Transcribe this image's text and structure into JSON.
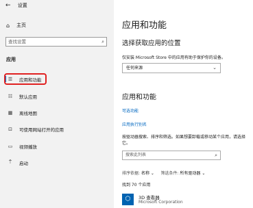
{
  "window": {
    "back_icon": "back-arrow-icon",
    "title": "设置"
  },
  "sidebar": {
    "home_label": "主页",
    "search_placeholder": "查找设置",
    "category": "应用",
    "items": [
      {
        "label": "应用和功能",
        "icon": "apps-list-icon",
        "active": true
      },
      {
        "label": "默认应用",
        "icon": "default-apps-icon",
        "active": false
      },
      {
        "label": "离线地图",
        "icon": "map-icon",
        "active": false
      },
      {
        "label": "可使用网站打开的应用",
        "icon": "website-apps-icon",
        "active": false
      },
      {
        "label": "视频播放",
        "icon": "video-icon",
        "active": false
      },
      {
        "label": "启动",
        "icon": "startup-icon",
        "active": false
      }
    ]
  },
  "main": {
    "title": "应用和功能",
    "install_source": {
      "heading": "选择获取应用的位置",
      "description": "仅安装 Microsoft Store 中的应用有助于保护你的设备。",
      "selected": "任何来源"
    },
    "apps": {
      "heading": "应用和功能",
      "optional_features_link": "可选功能",
      "aliases_link": "应用执行别名",
      "help_text": "按驱动器搜索、排序和筛选。如果想要卸载或移动某个应用，请选择它。",
      "search_placeholder": "搜索此列表",
      "sort_label": "排序依据:",
      "sort_value": "名称",
      "filter_label": "筛选条件:",
      "filter_value": "所有驱动器",
      "found_text": "找到 70 个应用",
      "list": [
        {
          "name": "3D 查看器",
          "publisher": "Microsoft Corporation"
        }
      ]
    }
  },
  "colors": {
    "accent": "#0078d4",
    "link": "#0067c0",
    "highlight_outline": "#e02020",
    "sidebar_bg": "#f2f2f2"
  }
}
